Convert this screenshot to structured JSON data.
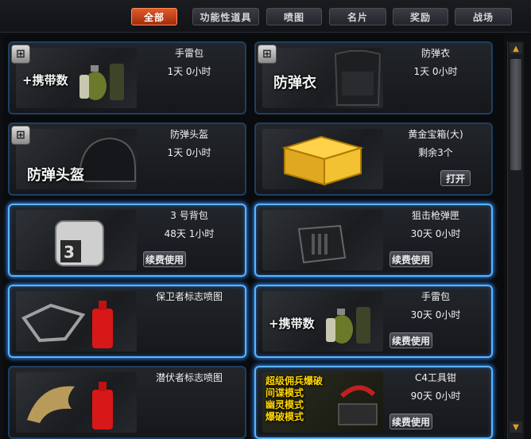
{
  "tabs": [
    {
      "label": "全部",
      "active": true
    },
    {
      "label": "功能性道具",
      "active": false
    },
    {
      "label": "喷图",
      "active": false
    },
    {
      "label": "名片",
      "active": false
    },
    {
      "label": "奖励",
      "active": false
    },
    {
      "label": "战场",
      "active": false
    }
  ],
  "items": [
    {
      "name": "手雷包",
      "duration": "1天  0小时",
      "thumb_text": "+携带数",
      "badge": "⊞",
      "button": ""
    },
    {
      "name": "防弹衣",
      "duration": "1天  0小时",
      "thumb_text": "防弹衣",
      "badge": "⊞",
      "button": ""
    },
    {
      "name": "防弹头盔",
      "duration": "1天  0小时",
      "thumb_text": "防弹头盔",
      "badge": "⊞",
      "button": ""
    },
    {
      "name": "黄金宝箱(大)",
      "duration": "剩余3个",
      "thumb_text": "",
      "badge": "",
      "button": "打开"
    },
    {
      "name": "3  号背包",
      "duration": "48天  1小时",
      "thumb_text": "",
      "badge": "",
      "button": "续费使用"
    },
    {
      "name": "狙击枪弹匣",
      "duration": "30天  0小时",
      "thumb_text": "",
      "badge": "",
      "button": "续费使用"
    },
    {
      "name": "保卫者标志喷图",
      "duration": "",
      "thumb_text": "",
      "badge": "",
      "button": ""
    },
    {
      "name": "手雷包",
      "duration": "30天  0小时",
      "thumb_text": "+携带数",
      "badge": "",
      "button": "续费使用"
    },
    {
      "name": "潜伏者标志喷图",
      "duration": "",
      "thumb_text": "",
      "badge": "",
      "button": ""
    },
    {
      "name": "C4工具钳",
      "duration": "90天  0小时",
      "thumb_text": "超级佣兵爆破\n间谍模式\n幽灵模式\n爆破模式",
      "badge": "",
      "button": "续费使用"
    }
  ],
  "scrollbar": {
    "up": "▲",
    "down": "▼"
  },
  "colors": {
    "accent": "#e15a2a",
    "glow": "#5ab4ff"
  }
}
